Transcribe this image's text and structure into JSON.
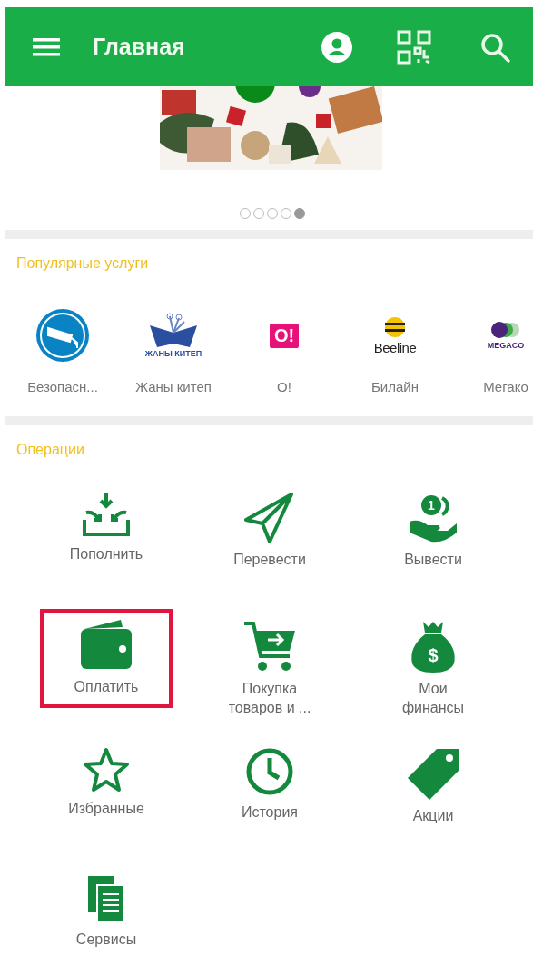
{
  "header": {
    "title": "Главная"
  },
  "banner": {
    "kind": "picture",
    "dots": [
      {
        "selected": false
      },
      {
        "selected": false
      },
      {
        "selected": false
      },
      {
        "selected": false
      },
      {
        "selected": true
      }
    ]
  },
  "popular": {
    "title": "Популярные услуги",
    "items": [
      {
        "label": "Безопасн...",
        "kind": "camera"
      },
      {
        "label": "Жаны китеп",
        "kind": "book",
        "logo_text": "ЖАНЫ КИТЕП"
      },
      {
        "label": "О!",
        "kind": "speech",
        "logo_text": "O!"
      },
      {
        "label": "Билайн",
        "kind": "stripes",
        "logo_text": "Beeline"
      },
      {
        "label": "Мегако",
        "kind": "dots",
        "logo_text": "MEGACO"
      }
    ]
  },
  "operations": {
    "title": "Операции",
    "items": [
      {
        "label": "Пополнить",
        "kind": "inbox",
        "highlighted": false
      },
      {
        "label": "Перевести",
        "kind": "plane",
        "highlighted": false
      },
      {
        "label": "Вывести",
        "kind": "coin-hand",
        "icon_glyph": "1",
        "highlighted": false
      },
      {
        "label": "Оплатить",
        "kind": "wallet",
        "highlighted": true
      },
      {
        "label": "Покупка товаров и ...",
        "kind": "cart",
        "highlighted": false
      },
      {
        "label": "Мои финансы",
        "kind": "moneybag",
        "icon_glyph": "$",
        "highlighted": false
      },
      {
        "label": "Избранные",
        "kind": "star",
        "highlighted": false
      },
      {
        "label": "История",
        "kind": "clock",
        "highlighted": false
      },
      {
        "label": "Акции",
        "kind": "tag",
        "highlighted": false
      },
      {
        "label": "Сервисы",
        "kind": "docs",
        "highlighted": false
      }
    ]
  }
}
